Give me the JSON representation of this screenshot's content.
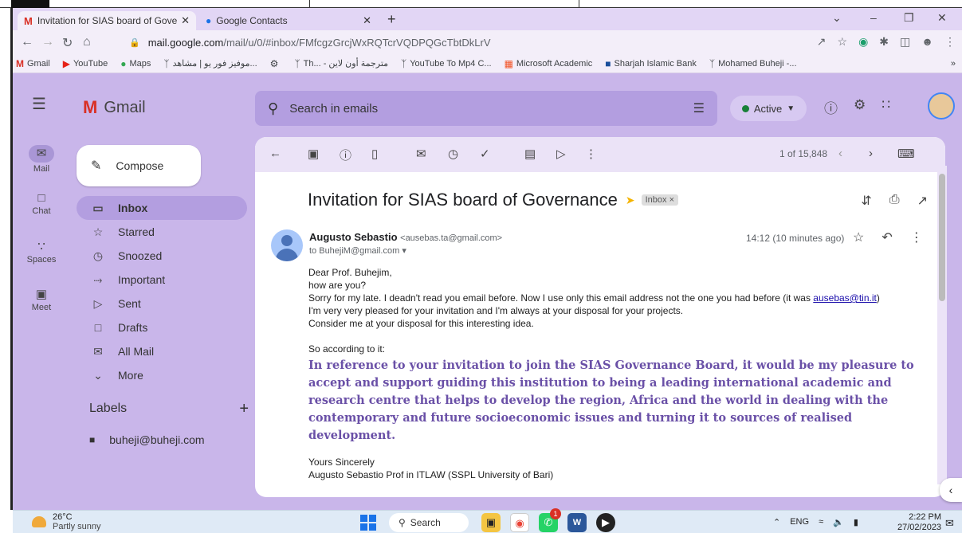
{
  "browser": {
    "tabs": [
      {
        "label": "Invitation for SIAS board of Gove",
        "close": "✕"
      },
      {
        "label": "Google Contacts",
        "close": "✕"
      }
    ],
    "new_tab": "+",
    "url_host": "mail.google.com",
    "url_path": "/mail/u/0/#inbox/FMfcgzGrcjWxRQTcrVQDPQGcTbtDkLrV",
    "bookmarks": [
      "Gmail",
      "YouTube",
      "Maps",
      "موفيز فور يو | مشاهد...",
      "",
      "Th... - مترجمة أون لاين",
      "YouTube To Mp4 C...",
      "Microsoft Academic",
      "Sharjah Islamic Bank",
      "Mohamed Buheji -..."
    ],
    "bookmarks_more": "»"
  },
  "gmail": {
    "brand": "Gmail",
    "search_placeholder": "Search in emails",
    "status": "Active",
    "rail": [
      {
        "label": "Mail",
        "icon": "mail-icon"
      },
      {
        "label": "Chat",
        "icon": "chat-icon"
      },
      {
        "label": "Spaces",
        "icon": "spaces-icon"
      },
      {
        "label": "Meet",
        "icon": "meet-icon"
      }
    ],
    "compose": "Compose",
    "nav": [
      {
        "label": "Inbox",
        "icon": "inbox-icon"
      },
      {
        "label": "Starred",
        "icon": "star-icon"
      },
      {
        "label": "Snoozed",
        "icon": "clock-icon"
      },
      {
        "label": "Important",
        "icon": "important-icon"
      },
      {
        "label": "Sent",
        "icon": "send-icon"
      },
      {
        "label": "Drafts",
        "icon": "draft-icon"
      },
      {
        "label": "All Mail",
        "icon": "all-mail-icon"
      },
      {
        "label": "More",
        "icon": "chevron-down-icon"
      }
    ],
    "labels_heading": "Labels",
    "labels": [
      "buheji@buheji.com"
    ],
    "pager": "1 of 15,848"
  },
  "message": {
    "subject": "Invitation for SIAS board of Governance",
    "badge": "Inbox ×",
    "sender_name": "Augusto Sebastio",
    "sender_email": "<ausebas.ta@gmail.com>",
    "to": "to BuhejiM@gmail.com ▾",
    "time": "14:12 (10 minutes ago)",
    "lines": [
      "Dear Prof. Buhejim,",
      "how are you?",
      "Sorry for my late. I deadn't read you email before. Now I use only this email address not the one you had before (it was ",
      "I'm very very pleased for your invitation and I'm always at your disposal for your projects.",
      "Consider me at your disposal for this interesting idea."
    ],
    "old_email": "ausebas@tin.it",
    "old_email_close": ")",
    "lead_in": "So according to it:",
    "quote": "In reference to your invitation to join the SIAS Governance Board, it would be my pleasure to accept and support guiding this institution to being a leading international academic and research centre that helps to develop the region, Africa and the world in dealing with the contemporary and future socioeconomic issues and turning it to sources of realised development.",
    "closing": "Yours Sincerely",
    "signature": "Augusto Sebastio Prof in ITLAW (SSPL University of Bari)"
  },
  "taskbar": {
    "temp": "26°C",
    "weather": "Partly sunny",
    "search": "Search",
    "lang": "ENG",
    "time": "2:22 PM",
    "date": "27/02/2023",
    "badge": "1"
  }
}
